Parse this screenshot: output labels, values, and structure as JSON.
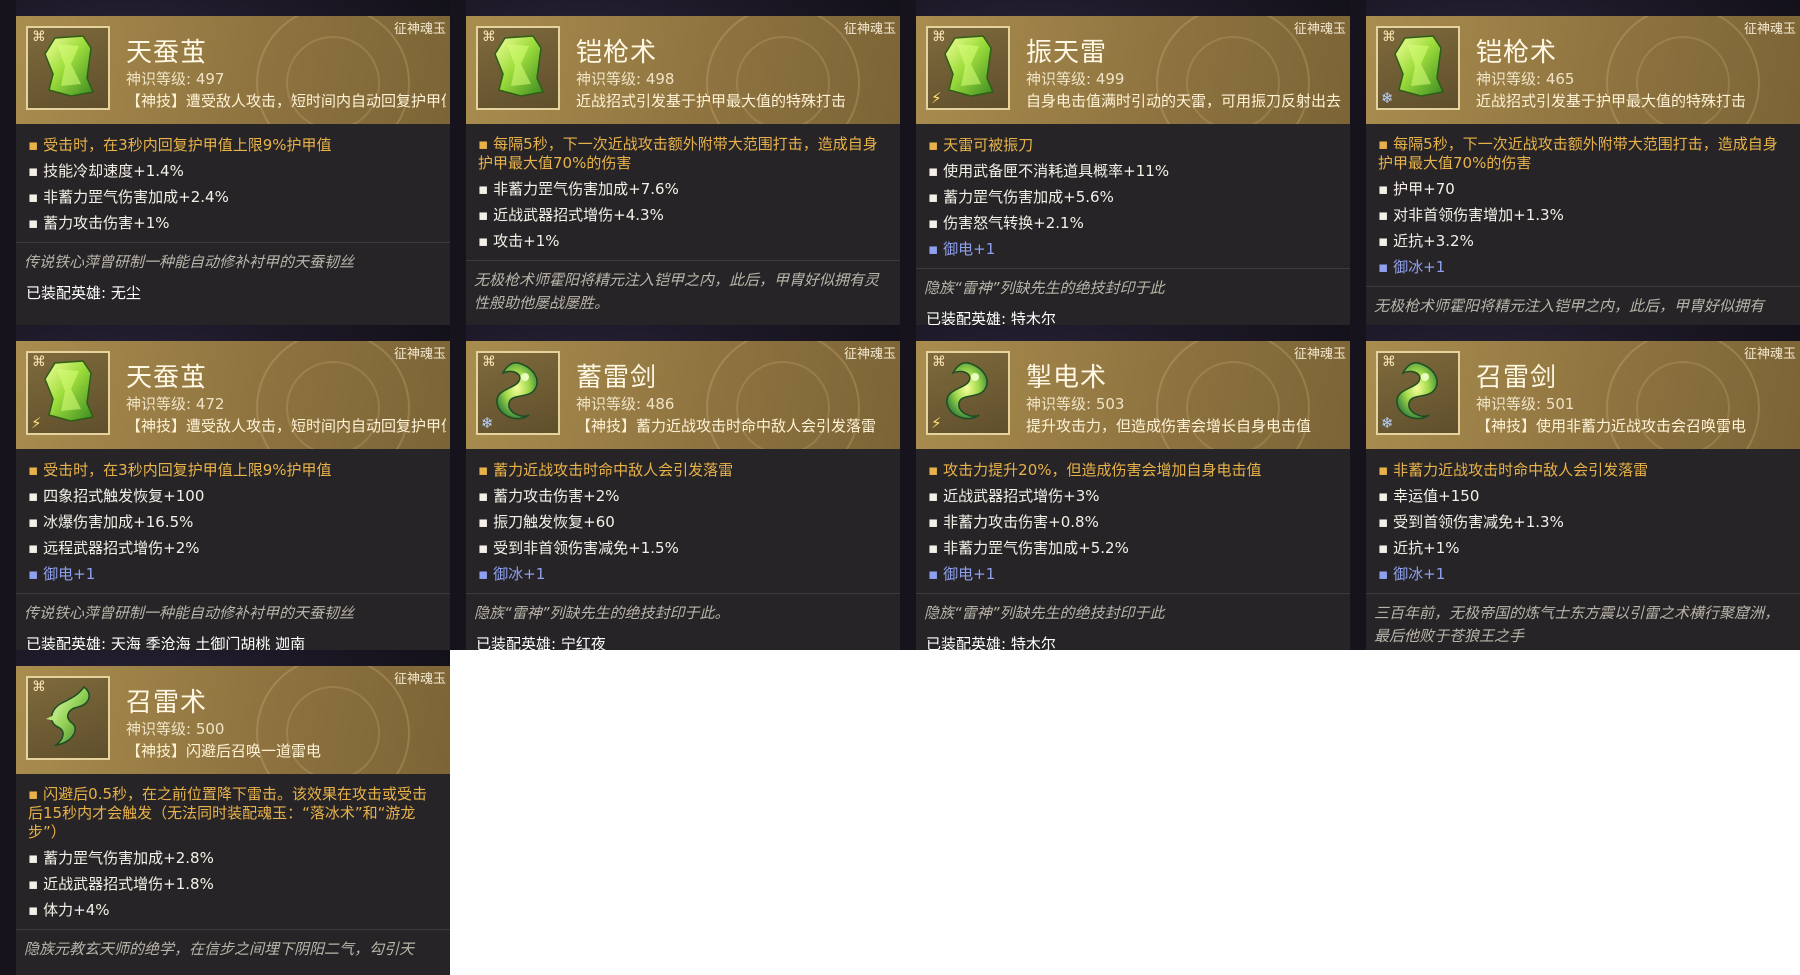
{
  "source_tag": "征神魂玉",
  "equip_label": "已装配英雄:",
  "cards": [
    {
      "name": "天蚕茧",
      "level": "神识等级: 497",
      "desc": "【神技】遭受敌人攻击，短时间内自动回复护甲值",
      "gem": "green",
      "badge": "",
      "attrs": [
        {
          "text": "受击时，在3秒内回复护甲值上限9%护甲值",
          "style": "gold"
        },
        {
          "text": "技能冷却速度+1.4%",
          "style": "normal"
        },
        {
          "text": "非蓄力罡气伤害加成+2.4%",
          "style": "normal"
        },
        {
          "text": "蓄力攻击伤害+1%",
          "style": "normal"
        }
      ],
      "flavor": "传说铁心萍曾研制一种能自动修补衬甲的天蚕韧丝",
      "equip": "已装配英雄: 无尘"
    },
    {
      "name": "铠枪术",
      "level": "神识等级: 498",
      "desc": "近战招式引发基于护甲最大值的特殊打击",
      "gem": "green",
      "badge": "",
      "attrs": [
        {
          "text": "每隔5秒，下一次近战攻击额外附带大范围打击，造成自身护甲最大值70%的伤害",
          "style": "gold-wrap"
        },
        {
          "text": "非蓄力罡气伤害加成+7.6%",
          "style": "normal"
        },
        {
          "text": "近战武器招式增伤+4.3%",
          "style": "normal"
        },
        {
          "text": "攻击+1%",
          "style": "normal"
        }
      ],
      "flavor": "无极枪术师霍阳将精元注入铠甲之内，此后，甲胄好似拥有灵性般助他屡战屡胜。",
      "equip": ""
    },
    {
      "name": "振天雷",
      "level": "神识等级: 499",
      "desc": "自身电击值满时引动的天雷，可用振刀反射出去",
      "gem": "green",
      "badge": "bolt",
      "attrs": [
        {
          "text": "天雷可被振刀",
          "style": "gold"
        },
        {
          "text": "使用武备匣不消耗道具概率+11%",
          "style": "normal"
        },
        {
          "text": "蓄力罡气伤害加成+5.6%",
          "style": "normal"
        },
        {
          "text": "伤害怒气转换+2.1%",
          "style": "normal"
        },
        {
          "text": "御电+1",
          "style": "blue"
        }
      ],
      "flavor": "隐族“雷神”列缺先生的绝技封印于此",
      "equip": "已装配英雄: 特木尔"
    },
    {
      "name": "铠枪术",
      "level": "神识等级: 465",
      "desc": "近战招式引发基于护甲最大值的特殊打击",
      "gem": "green",
      "badge": "snow",
      "attrs": [
        {
          "text": "每隔5秒，下一次近战攻击额外附带大范围打击，造成自身护甲最大值70%的伤害",
          "style": "gold-wrap"
        },
        {
          "text": "护甲+70",
          "style": "normal"
        },
        {
          "text": "对非首领伤害增加+1.3%",
          "style": "normal"
        },
        {
          "text": "近抗+3.2%",
          "style": "normal"
        },
        {
          "text": "御冰+1",
          "style": "blue"
        }
      ],
      "flavor": "无极枪术师霍阳将精元注入铠甲之内，此后，甲胄好似拥有",
      "equip": ""
    },
    {
      "name": "天蚕茧",
      "level": "神识等级: 472",
      "desc": "【神技】遭受敌人攻击，短时间内自动回复护甲值",
      "gem": "green",
      "badge": "bolt",
      "attrs": [
        {
          "text": "受击时，在3秒内回复护甲值上限9%护甲值",
          "style": "gold"
        },
        {
          "text": "四象招式触发恢复+100",
          "style": "normal"
        },
        {
          "text": "冰爆伤害加成+16.5%",
          "style": "normal"
        },
        {
          "text": "远程武器招式增伤+2%",
          "style": "normal"
        },
        {
          "text": "御电+1",
          "style": "blue"
        }
      ],
      "flavor": "传说铁心萍曾研制一种能自动修补衬甲的天蚕韧丝",
      "equip": "已装配英雄: 天海 季沧海 土御门胡桃 迦南"
    },
    {
      "name": "蓄雷剑",
      "level": "神识等级: 486",
      "desc": "【神技】蓄力近战攻击时命中敌人会引发落雷",
      "gem": "swirl",
      "badge": "snow",
      "attrs": [
        {
          "text": "蓄力近战攻击时命中敌人会引发落雷",
          "style": "gold"
        },
        {
          "text": "蓄力攻击伤害+2%",
          "style": "normal"
        },
        {
          "text": "振刀触发恢复+60",
          "style": "normal"
        },
        {
          "text": "受到非首领伤害减免+1.5%",
          "style": "normal"
        },
        {
          "text": "御冰+1",
          "style": "blue"
        }
      ],
      "flavor": "隐族“雷神”列缺先生的绝技封印于此。",
      "equip": "已装配英雄: 宁红夜"
    },
    {
      "name": "掣电术",
      "level": "神识等级: 503",
      "desc": "提升攻击力，但造成伤害会增长自身电击值",
      "gem": "swirl",
      "badge": "bolt",
      "attrs": [
        {
          "text": "攻击力提升20%，但造成伤害会增加自身电击值",
          "style": "gold"
        },
        {
          "text": "近战武器招式增伤+3%",
          "style": "normal"
        },
        {
          "text": "非蓄力攻击伤害+0.8%",
          "style": "normal"
        },
        {
          "text": "非蓄力罡气伤害加成+5.2%",
          "style": "normal"
        },
        {
          "text": "御电+1",
          "style": "blue"
        }
      ],
      "flavor": "隐族“雷神”列缺先生的绝技封印于此",
      "equip": "已装配英雄: 特木尔"
    },
    {
      "name": "召雷剑",
      "level": "神识等级: 501",
      "desc": "【神技】使用非蓄力近战攻击会召唤雷电",
      "gem": "swirl",
      "badge": "snow",
      "attrs": [
        {
          "text": "非蓄力近战攻击时命中敌人会引发落雷",
          "style": "gold"
        },
        {
          "text": "幸运值+150",
          "style": "normal"
        },
        {
          "text": "受到首领伤害减免+1.3%",
          "style": "normal"
        },
        {
          "text": "近抗+1%",
          "style": "normal"
        },
        {
          "text": "御冰+1",
          "style": "blue"
        }
      ],
      "flavor": "三百年前，无极帝国的炼气士东方震以引雷之术横行聚窟洲，最后他败于苍狼王之手",
      "equip": ""
    },
    {
      "name": "召雷术",
      "level": "神识等级: 500",
      "desc": "【神技】闪避后召唤一道雷电",
      "gem": "dragon",
      "badge": "",
      "attrs": [
        {
          "text": "闪避后0.5秒，在之前位置降下雷击。该效果在攻击或受击后15秒内才会触发（无法同时装配魂玉：“落冰术”和“游龙步”）",
          "style": "gold-wrap"
        },
        {
          "text": "蓄力罡气伤害加成+2.8%",
          "style": "normal"
        },
        {
          "text": "近战武器招式增伤+1.8%",
          "style": "normal"
        },
        {
          "text": "体力+4%",
          "style": "normal"
        }
      ],
      "flavor": "隐族元教玄天师的绝学，在信步之间埋下阴阳二气，勾引天",
      "equip": ""
    }
  ]
}
